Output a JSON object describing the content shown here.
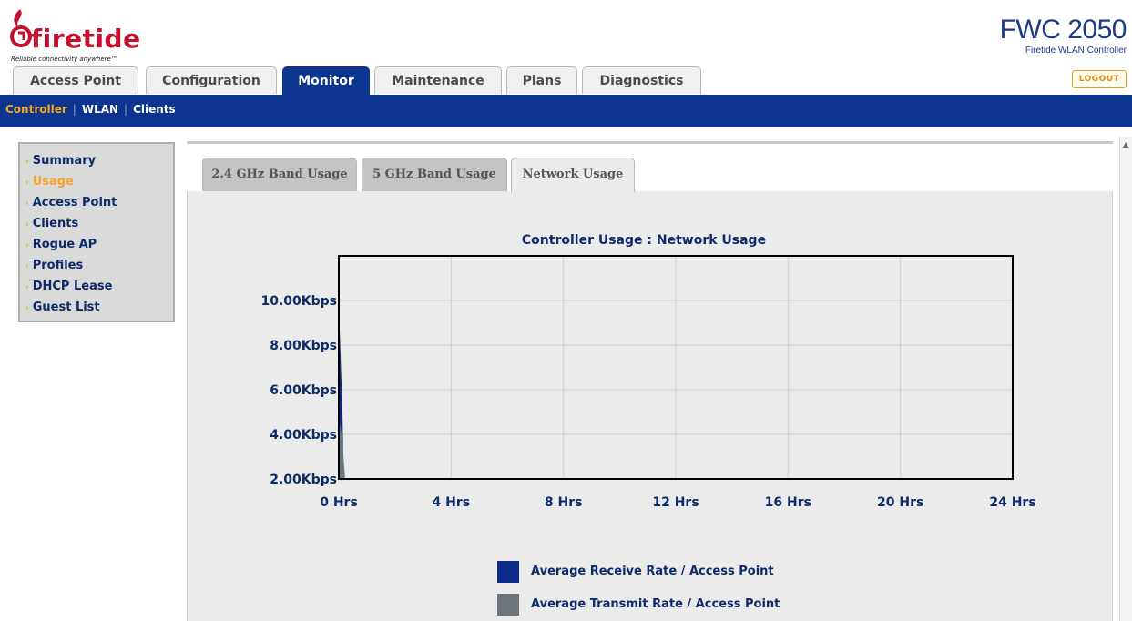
{
  "brand": {
    "logo_text": "firetide",
    "tagline": "Reliable connectivity anywhere™",
    "product_name": "FWC 2050",
    "product_sub": "Firetide WLAN Controller",
    "logout_label": "LOGOUT",
    "brand_red": "#c8102e",
    "brand_blue": "#0c3590",
    "accent_orange": "#f5a623"
  },
  "main_tabs": [
    {
      "label": "Access Point",
      "active": false
    },
    {
      "label": "Configuration",
      "active": false
    },
    {
      "label": "Monitor",
      "active": true
    },
    {
      "label": "Maintenance",
      "active": false
    },
    {
      "label": "Plans",
      "active": false
    },
    {
      "label": "Diagnostics",
      "active": false
    }
  ],
  "sub_nav": [
    {
      "label": "Controller",
      "active": true
    },
    {
      "label": "WLAN",
      "active": false
    },
    {
      "label": "Clients",
      "active": false
    }
  ],
  "sidebar": {
    "items": [
      {
        "label": "Summary",
        "active": false
      },
      {
        "label": "Usage",
        "active": true
      },
      {
        "label": "Access Point",
        "active": false
      },
      {
        "label": "Clients",
        "active": false
      },
      {
        "label": "Rogue AP",
        "active": false
      },
      {
        "label": "Profiles",
        "active": false
      },
      {
        "label": "DHCP Lease",
        "active": false
      },
      {
        "label": "Guest List",
        "active": false
      }
    ]
  },
  "content_tabs": [
    {
      "label": "2.4 GHz Band Usage",
      "active": false
    },
    {
      "label": "5 GHz Band Usage",
      "active": false
    },
    {
      "label": "Network Usage",
      "active": true
    }
  ],
  "chart_data": {
    "type": "area",
    "title": "Controller Usage : Network Usage",
    "xlabel": "",
    "ylabel": "",
    "x_ticks": [
      "0 Hrs",
      "4 Hrs",
      "8 Hrs",
      "12 Hrs",
      "16 Hrs",
      "20 Hrs",
      "24 Hrs"
    ],
    "x_tick_values": [
      0,
      4,
      8,
      12,
      16,
      20,
      24
    ],
    "y_ticks": [
      "2.00Kbps",
      "4.00Kbps",
      "6.00Kbps",
      "8.00Kbps",
      "10.00Kbps"
    ],
    "y_tick_values": [
      2,
      4,
      6,
      8,
      10
    ],
    "xlim": [
      0,
      24
    ],
    "ylim": [
      2,
      12
    ],
    "grid": true,
    "legend_position": "bottom",
    "series": [
      {
        "name": "Average Receive Rate / Access Point",
        "color": "#0d2b8a",
        "x": [
          0,
          0.05,
          0.1,
          0.15
        ],
        "y": [
          9.0,
          7.1,
          5.4,
          2.0
        ]
      },
      {
        "name": "Average Transmit Rate / Access Point",
        "color": "#6d767d",
        "x": [
          0,
          0.1,
          0.2
        ],
        "y": [
          4.6,
          3.8,
          2.0
        ]
      }
    ]
  }
}
